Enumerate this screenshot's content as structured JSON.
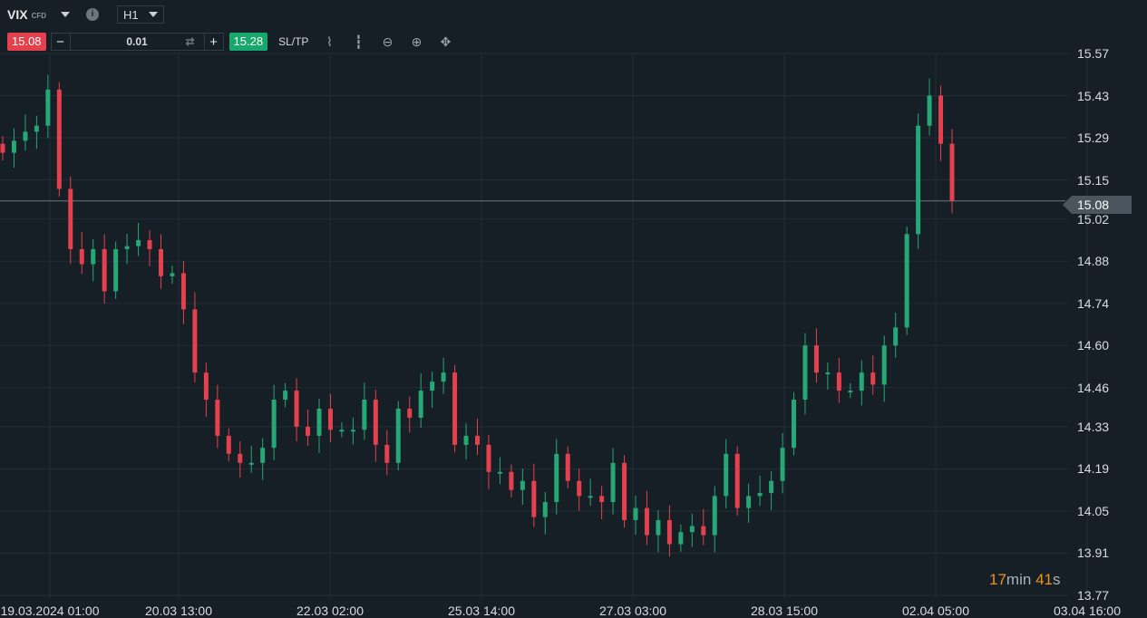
{
  "header": {
    "symbol": "VIX",
    "symbol_type": "CFD",
    "info_icon": "i",
    "timeframe": "H1"
  },
  "trade": {
    "sell_price": "15.08",
    "buy_price": "15.28",
    "quantity": "0.01",
    "minus": "−",
    "plus": "+",
    "sltp_label": "SL/TP"
  },
  "tools": [
    "line-chart-icon",
    "candles-icon",
    "zoom-out-icon",
    "zoom-in-icon",
    "move-icon"
  ],
  "timer": {
    "minutes": "17",
    "min_unit": "min",
    "seconds": "41",
    "sec_unit": "s"
  },
  "colors": {
    "up": "#26a776",
    "down": "#e4404d",
    "background": "#161f26",
    "grid": "#232d35"
  },
  "chart_data": {
    "type": "candlestick",
    "symbol": "VIX",
    "current_price": "15.08",
    "ylim": [
      13.77,
      15.57
    ],
    "y_ticks": [
      "15.57",
      "15.43",
      "15.29",
      "15.15",
      "15.02",
      "14.88",
      "14.74",
      "14.60",
      "14.46",
      "14.33",
      "14.19",
      "14.05",
      "13.91",
      "13.77"
    ],
    "x_ticks": [
      "19.03.2024 01:00",
      "20.03 13:00",
      "22.03 02:00",
      "25.03 14:00",
      "27.03 03:00",
      "28.03 15:00",
      "02.04 05:00",
      "03.04 16:00"
    ],
    "grid": true,
    "closes": [
      15.24,
      15.28,
      15.31,
      15.33,
      15.45,
      15.12,
      14.92,
      14.87,
      14.92,
      14.78,
      14.92,
      14.93,
      14.95,
      14.92,
      14.83,
      14.84,
      14.72,
      14.51,
      14.42,
      14.3,
      14.24,
      14.21,
      14.21,
      14.26,
      14.42,
      14.45,
      14.33,
      14.3,
      14.39,
      14.32,
      14.32,
      14.32,
      14.42,
      14.27,
      14.21,
      14.39,
      14.36,
      14.45,
      14.48,
      14.51,
      14.27,
      14.3,
      14.27,
      14.18,
      14.18,
      14.12,
      14.15,
      14.03,
      14.08,
      14.24,
      14.15,
      14.1,
      14.1,
      14.08,
      14.21,
      14.02,
      14.06,
      13.97,
      14.02,
      13.94,
      13.98,
      14.0,
      13.97,
      14.1,
      14.24,
      14.06,
      14.1,
      14.11,
      14.15,
      14.26,
      14.42,
      14.6,
      14.51,
      14.51,
      14.45,
      14.45,
      14.51,
      14.47,
      14.6,
      14.66,
      14.97,
      15.33,
      15.43,
      15.27,
      15.08
    ]
  }
}
